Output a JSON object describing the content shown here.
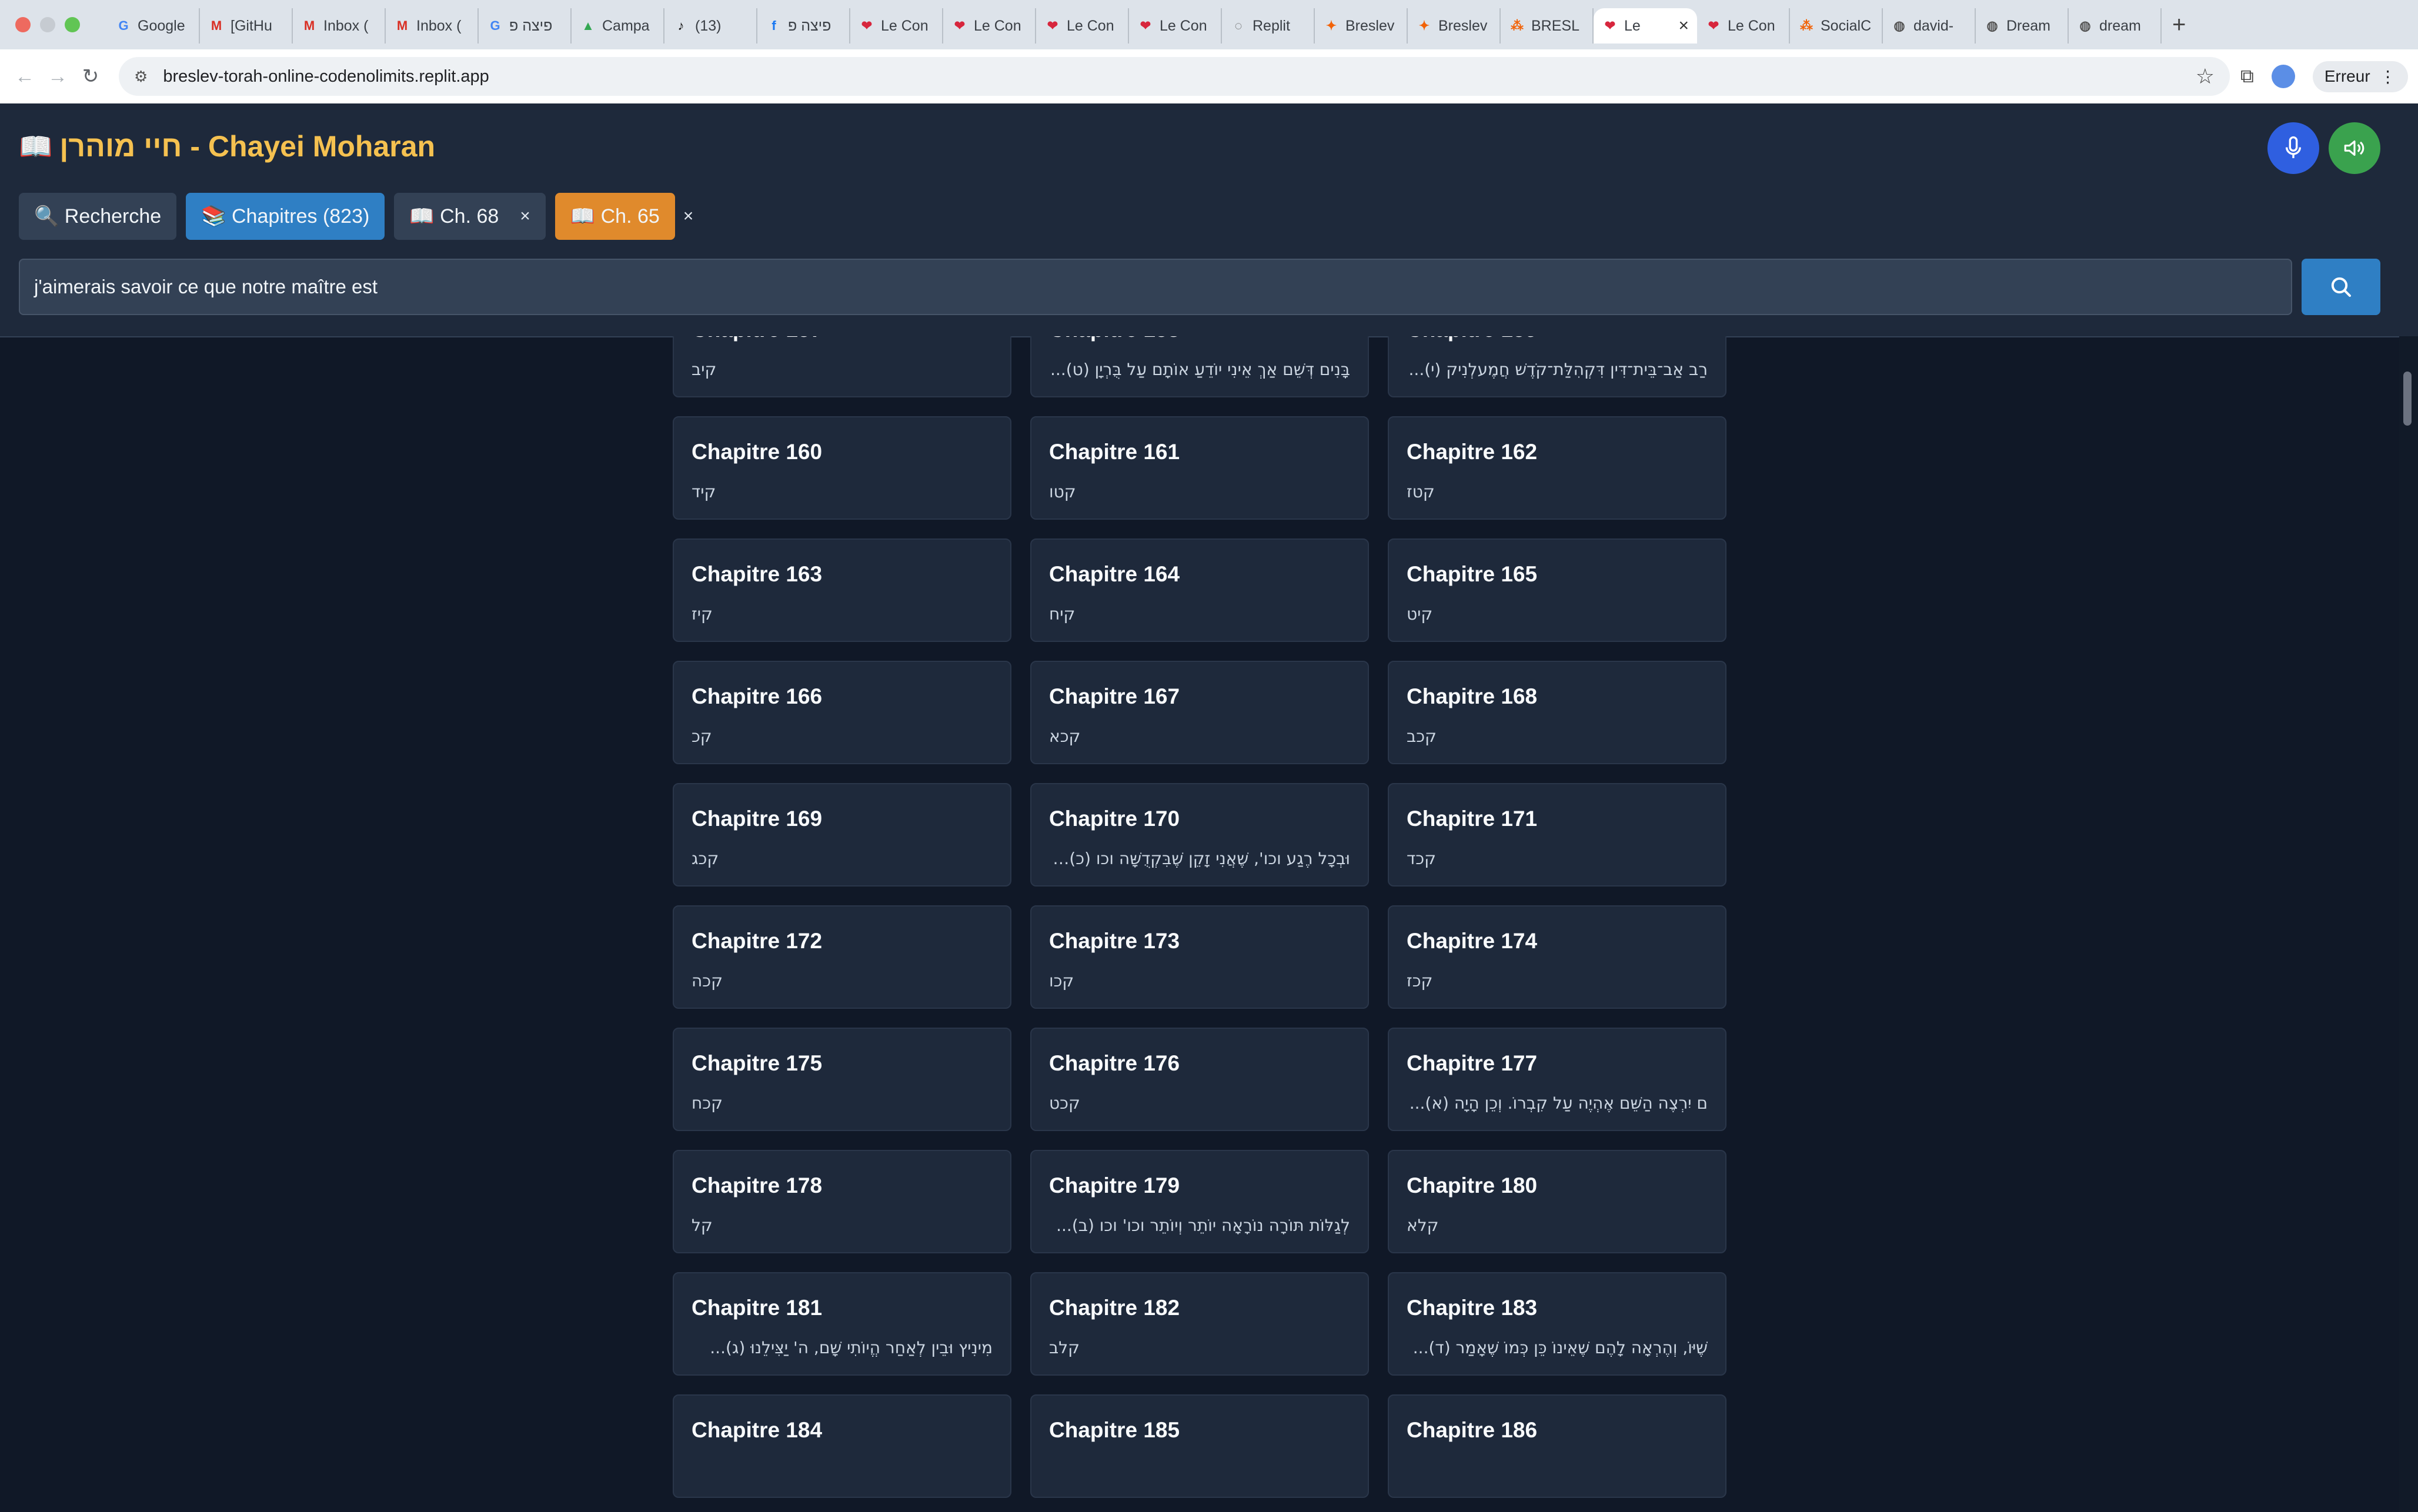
{
  "browser": {
    "tabs": [
      {
        "title": "Google",
        "icon": "G",
        "color": "#4285f4"
      },
      {
        "title": "[GitHu",
        "icon": "M",
        "color": "#d93025"
      },
      {
        "title": "Inbox (",
        "icon": "M",
        "color": "#d93025"
      },
      {
        "title": "Inbox (",
        "icon": "M",
        "color": "#d93025"
      },
      {
        "title": "פיצה פ",
        "icon": "G",
        "color": "#4285f4"
      },
      {
        "title": "Campa",
        "icon": "▲",
        "color": "#34a853"
      },
      {
        "title": "(13)",
        "icon": "♪",
        "color": "#111111"
      },
      {
        "title": "פיצה פ",
        "icon": "f",
        "color": "#1877f2"
      },
      {
        "title": "Le Con",
        "icon": "❤",
        "color": "#d7263d"
      },
      {
        "title": "Le Con",
        "icon": "❤",
        "color": "#d7263d"
      },
      {
        "title": "Le Con",
        "icon": "❤",
        "color": "#d7263d"
      },
      {
        "title": "Le Con",
        "icon": "❤",
        "color": "#d7263d"
      },
      {
        "title": "Replit",
        "icon": "◌",
        "color": "#555555"
      },
      {
        "title": "Breslev",
        "icon": "✦",
        "color": "#f26207"
      },
      {
        "title": "Breslev",
        "icon": "✦",
        "color": "#f26207"
      },
      {
        "title": "BRESL",
        "icon": "⁂",
        "color": "#f26207"
      },
      {
        "title": "Le",
        "icon": "❤",
        "color": "#d7263d",
        "active": true
      },
      {
        "title": "Le Con",
        "icon": "❤",
        "color": "#d7263d"
      },
      {
        "title": "SocialC",
        "icon": "⁂",
        "color": "#f26207"
      },
      {
        "title": "david-",
        "icon": "◍",
        "color": "#555555"
      },
      {
        "title": "Dream",
        "icon": "◍",
        "color": "#555555"
      },
      {
        "title": "dream",
        "icon": "◍",
        "color": "#555555"
      }
    ],
    "url": "breslev-torah-online-codenolimits.replit.app",
    "profile_button": "Erreur"
  },
  "header": {
    "title": "חיי מוהרן - Chayei Moharan",
    "book_icon": "📖"
  },
  "nav_tabs": {
    "search": "🔍 Recherche",
    "chapters": "📚 Chapitres (823)",
    "ch68": "📖 Ch. 68",
    "ch65": "📖 Ch. 65",
    "close_symbol": "×"
  },
  "search": {
    "value": "j'aimerais savoir ce que notre maître est"
  },
  "chapters": [
    {
      "title": "",
      "sub": ""
    },
    {
      "title": "",
      "sub": ""
    },
    {
      "title": "",
      "sub": ""
    },
    {
      "title": "Chapitre 157",
      "sub": "קיב"
    },
    {
      "title": "Chapitre 158",
      "sub": "בָּנִים דְּשֵׁם אַךְ אֵינִי יוֹדֵעַ אוֹתָם עַל בֻּרְיָן (ט)...",
      "long": true
    },
    {
      "title": "Chapitre 159",
      "sub": "רַב אַב־בֵּית־דִּין דִּקְהִלַּת־קֹדֶשׁ חֲמֶעלְנִיק (י)...",
      "long": true
    },
    {
      "title": "Chapitre 160",
      "sub": "קיד"
    },
    {
      "title": "Chapitre 161",
      "sub": "קטו"
    },
    {
      "title": "Chapitre 162",
      "sub": "קטז"
    },
    {
      "title": "Chapitre 163",
      "sub": "קיז"
    },
    {
      "title": "Chapitre 164",
      "sub": "קיח"
    },
    {
      "title": "Chapitre 165",
      "sub": "קיט"
    },
    {
      "title": "Chapitre 166",
      "sub": "קכ"
    },
    {
      "title": "Chapitre 167",
      "sub": "קכא"
    },
    {
      "title": "Chapitre 168",
      "sub": "קכב"
    },
    {
      "title": "Chapitre 169",
      "sub": "קכג"
    },
    {
      "title": "Chapitre 170",
      "sub": "וּבְכָל רֶגַע וכו', שֶׁאֲנִי זָקֵן שֶׁבִּקְדֻשָּׁה וכו (כ) ...",
      "long": true
    },
    {
      "title": "Chapitre 171",
      "sub": "קכד"
    },
    {
      "title": "Chapitre 172",
      "sub": "קכה"
    },
    {
      "title": "Chapitre 173",
      "sub": "קכו"
    },
    {
      "title": "Chapitre 174",
      "sub": "קכז"
    },
    {
      "title": "Chapitre 175",
      "sub": "קכח"
    },
    {
      "title": "Chapitre 176",
      "sub": "קכט"
    },
    {
      "title": "Chapitre 177",
      "sub": "ם יִרְצֶה הַשֵּׁם אֶהְיֶה עַל קִבְרוֹ. וְכֵן הָיָה (א)...",
      "long": true
    },
    {
      "title": "Chapitre 178",
      "sub": "קל"
    },
    {
      "title": "Chapitre 179",
      "sub": "לְגַלּוֹת תּוֹרָה נוֹרָאָה יוֹתֵר וְיוֹתֵר וכו' וכו (ב)...",
      "long": true
    },
    {
      "title": "Chapitre 180",
      "sub": "קלא"
    },
    {
      "title": "Chapitre 181",
      "sub": "מִינִיץ וּבֵין לְאַחַר הֱיוֹתִי שָׁם, ה' יַצִּילֵנוּ (ג)...",
      "long": true
    },
    {
      "title": "Chapitre 182",
      "sub": "קלב"
    },
    {
      "title": "Chapitre 183",
      "sub": "שֶׁיּוֹ, וְהֶרְאָה לָהֶם שֶׁאֵינוֹ כֵּן כְּמוֹ שֶׁאָמַר (ד)...",
      "long": true
    },
    {
      "title": "Chapitre 184",
      "sub": ""
    },
    {
      "title": "Chapitre 185",
      "sub": ""
    },
    {
      "title": "Chapitre 186",
      "sub": ""
    }
  ]
}
